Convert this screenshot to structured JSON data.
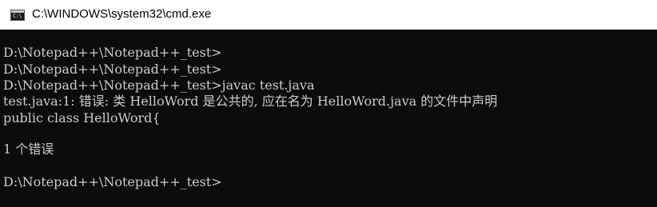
{
  "window": {
    "title": "C:\\WINDOWS\\system32\\cmd.exe",
    "icon": "cmd-icon"
  },
  "console": {
    "lines": [
      "D:\\Notepad++\\Notepad++_test>",
      "D:\\Notepad++\\Notepad++_test>",
      "D:\\Notepad++\\Notepad++_test>javac test.java",
      "test.java:1: 错误: 类 HelloWord 是公共的, 应在名为 HelloWord.java 的文件中声明",
      "public class HelloWord{",
      "",
      "1 个错误",
      "",
      "D:\\Notepad++\\Notepad++_test>"
    ]
  },
  "colors": {
    "console_background": "#0c0c0c",
    "console_text": "#cccccc",
    "titlebar_background": "#ffffff"
  }
}
